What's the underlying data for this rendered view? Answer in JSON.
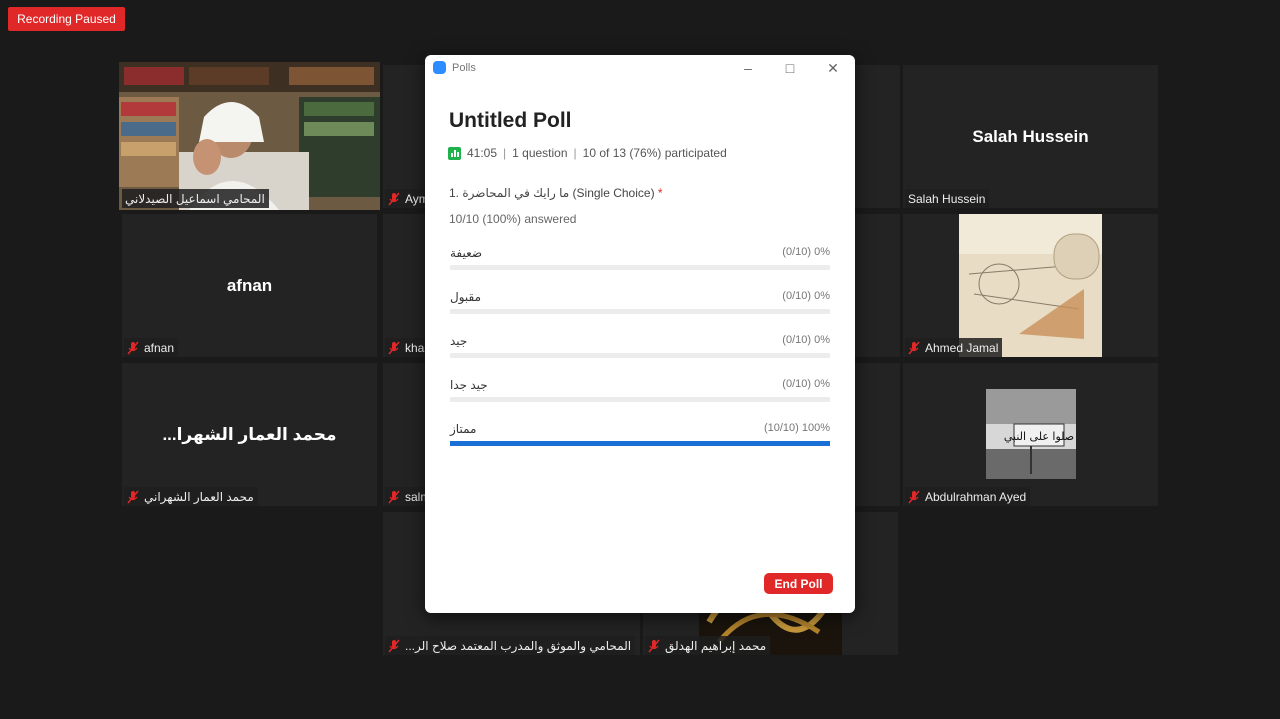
{
  "recording": {
    "label": "Recording Paused"
  },
  "tiles": {
    "t1_name": "المحامي اسماعيل الصيدلاني",
    "t2_name": "Aym",
    "t3_center": "Salah Hussein",
    "t3_name": "Salah Hussein",
    "t4_center": "afnan",
    "t4_name": "afnan",
    "t5_name": "kha",
    "t6_name": "Ahmed Jamal",
    "t7_center": "...محمد العمار الشهرا",
    "t7_name": "محمد العمار الشهراني",
    "t8_name": "salm",
    "t9_name": "Abdulrahman Ayed",
    "t10_name": "...المحامي والموثق والمدرب المعتمد صلاح الر",
    "t11_name": "محمد إبراهيم الهدلق"
  },
  "poll": {
    "window_title": "Polls",
    "title": "Untitled Poll",
    "duration": "41:05",
    "questions": "1 question",
    "participation": "10 of 13 (76%) participated",
    "question_text": "1. ما رايك في المحاضرة (Single Choice)",
    "required_mark": "*",
    "answered": "10/10 (100%) answered",
    "options": [
      {
        "label": "ضعيفة",
        "count": "(0/10) 0%",
        "fraction": 0.0
      },
      {
        "label": "مقبول",
        "count": "(0/10) 0%",
        "fraction": 0.0
      },
      {
        "label": "جيد",
        "count": "(0/10) 0%",
        "fraction": 0.0
      },
      {
        "label": "جيد جدا",
        "count": "(0/10) 0%",
        "fraction": 0.0
      },
      {
        "label": "ممتاز",
        "count": "(10/10) 100%",
        "fraction": 1.0
      }
    ],
    "end_label": "End Poll"
  },
  "colors": {
    "accent_red": "#e02828",
    "bar_blue": "#1a6fd6",
    "active_speaker": "#e7e77a"
  }
}
